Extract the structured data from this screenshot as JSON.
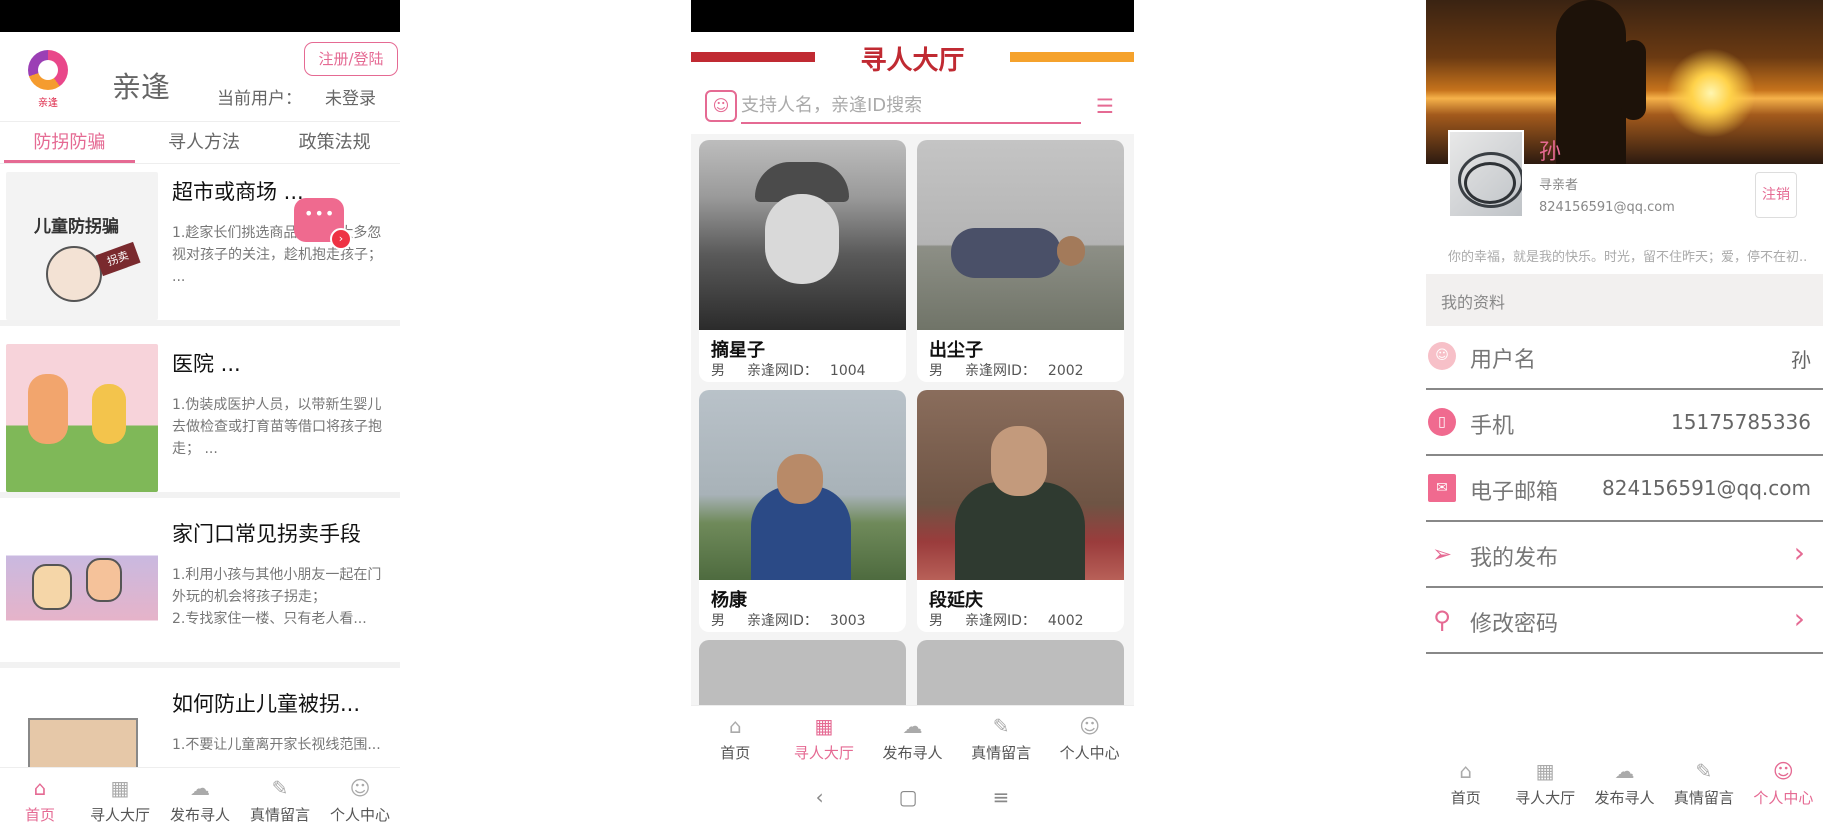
{
  "screen1": {
    "app_name": "亲逢",
    "logo_text": "亲逢",
    "register_label": "注册/登陆",
    "current_user_label": "当前用户：",
    "current_user_value": "未登录",
    "tabs": [
      "防拐防骗",
      "寻人方法",
      "政策法规"
    ],
    "active_tab": 0,
    "articles": [
      {
        "title": "超市或商场 ...",
        "desc": "1.趁家长们挑选商品张时，大多忽视对孩子的关注，趁机抱走孩子； ..."
      },
      {
        "title": "医院 ...",
        "desc": "1.伪装成医护人员，以带新生婴儿去做检查或打育苗等借口将孩子抱走； ..."
      },
      {
        "title": "家门口常见拐卖手段",
        "desc": "1.利用小孩与其他小朋友一起在门外玩的机会将孩子拐走；\n2.专找家住一楼、只有老人看..."
      },
      {
        "title": "如何防止儿童被拐...",
        "desc": "1.不要让儿童离开家长视线范围..."
      }
    ],
    "thumb1_text": "儿童防拐骗",
    "thumb1_tag": "拐卖"
  },
  "screen2": {
    "title": "寻人大厅",
    "search_placeholder": "支持人名，亲逢ID搜索",
    "id_label": "亲逢网ID：",
    "people": [
      {
        "name": "摘星子",
        "gender": "男",
        "id": "1004"
      },
      {
        "name": "出尘子",
        "gender": "男",
        "id": "2002"
      },
      {
        "name": "杨康",
        "gender": "男",
        "id": "3003"
      },
      {
        "name": "段延庆",
        "gender": "男",
        "id": "4002"
      }
    ]
  },
  "screen3": {
    "name": "孙",
    "role": "寻亲者",
    "email": "824156591@qq.com",
    "logout_label": "注销",
    "motto": "你的幸福，就是我的快乐。时光，留不住昨天；爱，停不在初...",
    "section_title": "我的资料",
    "rows": [
      {
        "label": "用户名",
        "value": "孙"
      },
      {
        "label": "手机",
        "value": "15175785336"
      },
      {
        "label": "电子邮箱",
        "value": "824156591@qq.com"
      },
      {
        "label": "我的发布",
        "value": ""
      },
      {
        "label": "修改密码",
        "value": ""
      }
    ]
  },
  "nav": [
    "首页",
    "寻人大厅",
    "发布寻人",
    "真情留言",
    "个人中心"
  ],
  "colors": {
    "accent": "#e56a93",
    "hall_red": "#c02a32",
    "hall_orange": "#f5a22c"
  }
}
